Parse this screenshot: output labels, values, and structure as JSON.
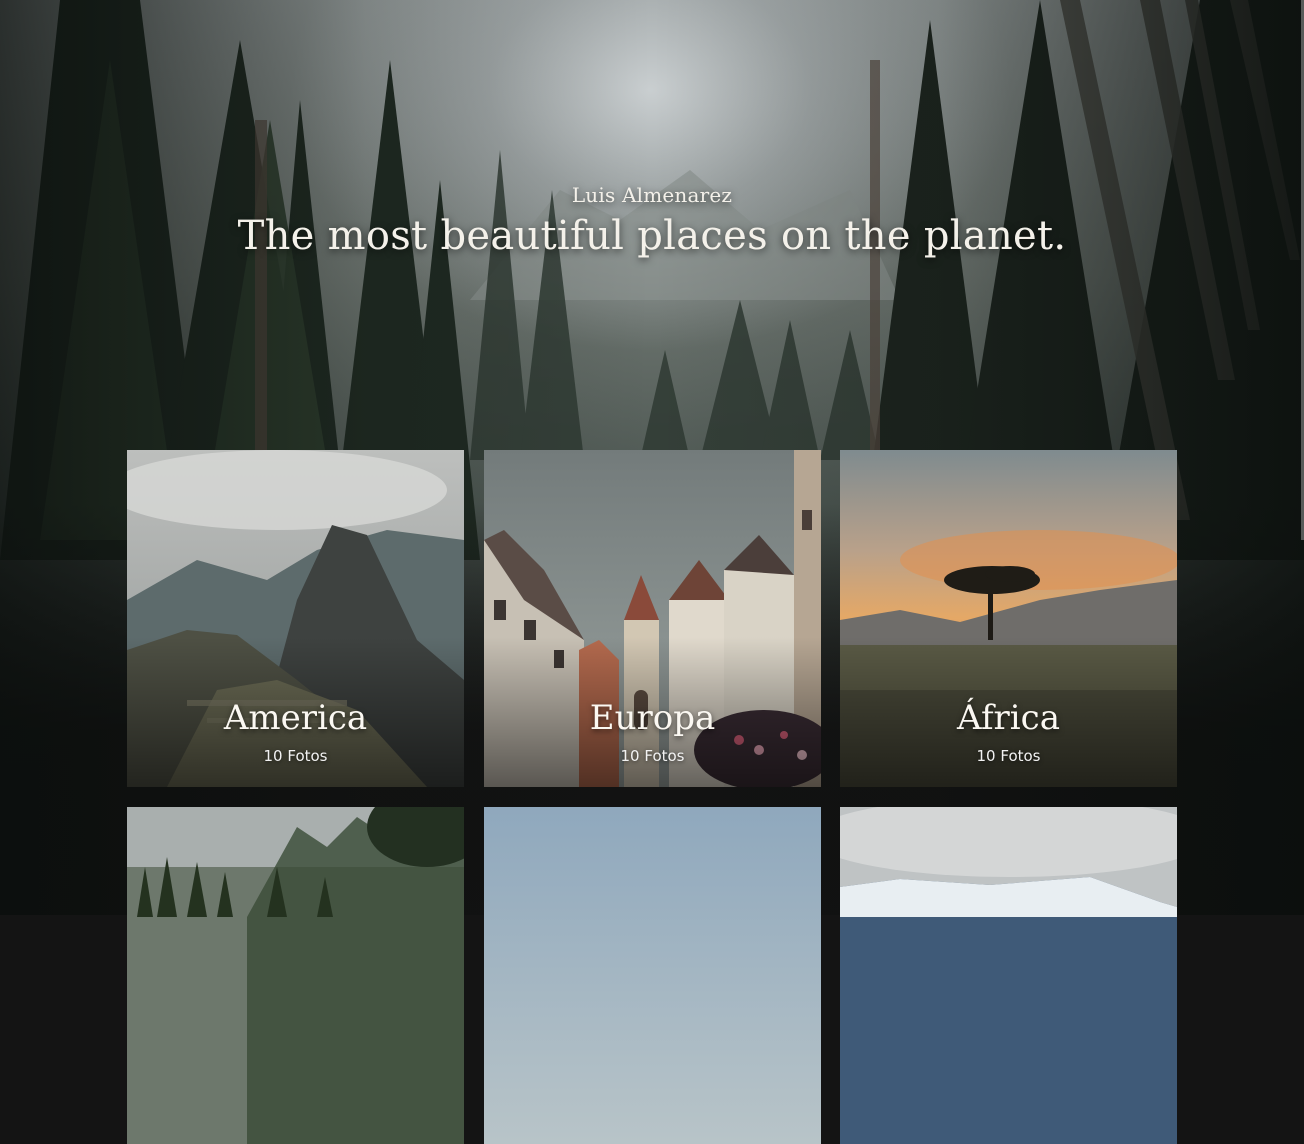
{
  "hero": {
    "author": "Luis Almenarez",
    "tagline": "The most beautiful places on the planet."
  },
  "colors": {
    "page_background": "#141414",
    "text_light": "#f4f1ea"
  },
  "gallery": {
    "cards": [
      {
        "title": "America",
        "count": "10 Fotos"
      },
      {
        "title": "Europa",
        "count": "10 Fotos"
      },
      {
        "title": "África",
        "count": "10 Fotos"
      },
      {
        "title": "",
        "count": ""
      },
      {
        "title": "",
        "count": ""
      },
      {
        "title": "",
        "count": ""
      }
    ]
  }
}
